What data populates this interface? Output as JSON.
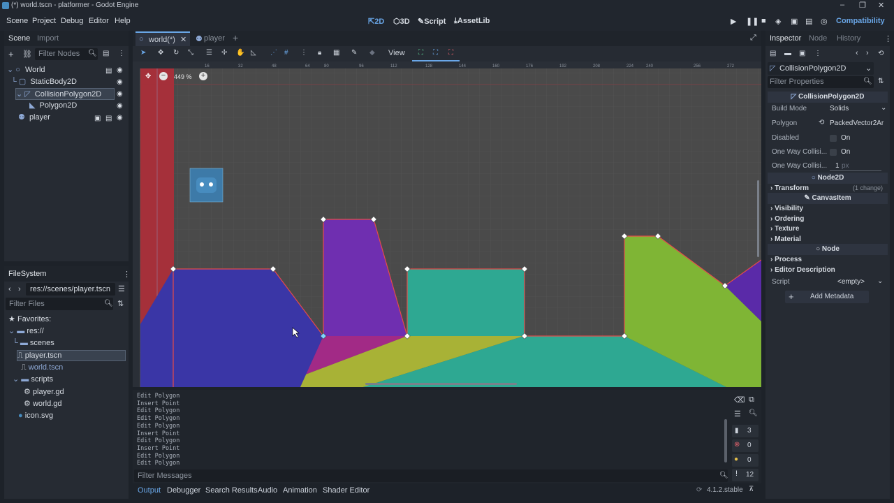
{
  "window": {
    "title": "(*) world.tscn - platformer - Godot Engine"
  },
  "menu": [
    "Scene",
    "Project",
    "Debug",
    "Editor",
    "Help"
  ],
  "workspaces": {
    "w2d": "2D",
    "w3d": "3D",
    "script": "Script",
    "assetlib": "AssetLib"
  },
  "renderer": "Compatibility",
  "scene_dock": {
    "tabs": [
      "Scene",
      "Import"
    ],
    "filter_placeholder": "Filter Nodes",
    "nodes": [
      "World",
      "StaticBody2D",
      "CollisionPolygon2D",
      "Polygon2D",
      "player"
    ]
  },
  "filesystem": {
    "tab": "FileSystem",
    "path": "res://scenes/player.tscn",
    "filter_placeholder": "Filter Files",
    "favorites": "Favorites:",
    "root": "res://",
    "scenes": "scenes",
    "player_tscn": "player.tscn",
    "world_tscn": "world.tscn",
    "scripts": "scripts",
    "player_gd": "player.gd",
    "world_gd": "world.gd",
    "icon": "icon.svg"
  },
  "editor_tabs": {
    "world": "world(*)",
    "player": "player"
  },
  "toolbar": {
    "view": "View"
  },
  "viewport": {
    "zoom": "449 %",
    "ruler": [
      "16",
      "32",
      "48",
      "64",
      "80",
      "96",
      "112",
      "128",
      "144",
      "160",
      "176",
      "192",
      "208",
      "224",
      "240",
      "256",
      "272"
    ]
  },
  "colors": {
    "accent": "#6aa7e8",
    "wall": "#a5303a",
    "blue": "#3a36a6",
    "purple": "#6f2fb0",
    "teal": "#2ea892",
    "green": "#7fb535",
    "magenta": "#a22a86",
    "yellow": "#a8b236"
  },
  "output": {
    "lines": [
      "Edit Polygon",
      "Insert Point",
      "Edit Polygon",
      "Edit Polygon",
      "Edit Polygon",
      "Insert Point",
      "Edit Polygon",
      "Insert Point",
      "Edit Polygon",
      "Edit Polygon"
    ],
    "filter_placeholder": "Filter Messages",
    "counts": {
      "log": "3",
      "errors": "0",
      "warnings": "0",
      "messages": "12"
    }
  },
  "bottom_tabs": [
    "Output",
    "Debugger",
    "Search Results",
    "Audio",
    "Animation",
    "Shader Editor"
  ],
  "version": "4.1.2.stable",
  "inspector": {
    "tabs": [
      "Inspector",
      "Node",
      "History"
    ],
    "object": "CollisionPolygon2D",
    "filter_placeholder": "Filter Properties",
    "class_header": "CollisionPolygon2D",
    "build_mode_label": "Build Mode",
    "build_mode_value": "Solids",
    "polygon_label": "Polygon",
    "polygon_value": "PackedVector2Ar",
    "disabled_label": "Disabled",
    "disabled_value": "On",
    "one_way_label": "One Way Collisi...",
    "one_way_value": "On",
    "one_way_margin_label": "One Way Collisi...",
    "one_way_margin_value": "1",
    "one_way_margin_unit": "px",
    "node2d_header": "Node2D",
    "transform": "Transform",
    "transform_changes": "(1 change)",
    "canvasitem_header": "CanvasItem",
    "visibility": "Visibility",
    "ordering": "Ordering",
    "texture": "Texture",
    "material": "Material",
    "node_header": "Node",
    "process": "Process",
    "editor_description": "Editor Description",
    "script_label": "Script",
    "script_value": "<empty>",
    "add_metadata": "Add Metadata"
  }
}
